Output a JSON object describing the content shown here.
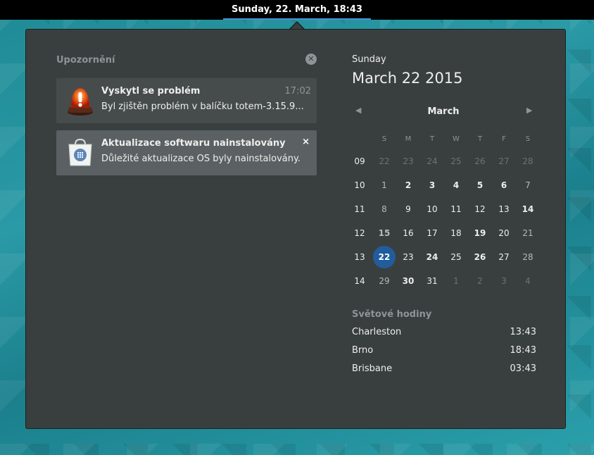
{
  "topbar": {
    "clock": "Sunday, 22. March, 18:43"
  },
  "notifications": {
    "header": "Upozornění",
    "clear_icon": "close-circle-icon",
    "items": [
      {
        "title": "Vyskytl se problém",
        "body": "Byl zjištěn problém v balíčku totem-3.15.9...",
        "time": "17:02",
        "icon": "alarm-beacon-icon"
      },
      {
        "title": "Aktualizace softwaru nainstalovány",
        "body": "Důležité aktualizace OS byly nainstalovány.",
        "close": "×",
        "icon": "software-bag-icon"
      }
    ]
  },
  "calendar": {
    "day_name": "Sunday",
    "full_date": "March 22 2015",
    "month": "March",
    "prev_icon": "triangle-left-icon",
    "next_icon": "triangle-right-icon",
    "weekdays": [
      "S",
      "M",
      "T",
      "W",
      "T",
      "F",
      "S"
    ],
    "weeks": [
      {
        "num": "09",
        "days": [
          "22",
          "23",
          "24",
          "25",
          "26",
          "27",
          "28"
        ]
      },
      {
        "num": "10",
        "days": [
          "1",
          "2",
          "3",
          "4",
          "5",
          "6",
          "7"
        ]
      },
      {
        "num": "11",
        "days": [
          "8",
          "9",
          "10",
          "11",
          "12",
          "13",
          "14"
        ]
      },
      {
        "num": "12",
        "days": [
          "15",
          "16",
          "17",
          "18",
          "19",
          "20",
          "21"
        ]
      },
      {
        "num": "13",
        "days": [
          "22",
          "23",
          "24",
          "25",
          "26",
          "27",
          "28"
        ]
      },
      {
        "num": "14",
        "days": [
          "29",
          "30",
          "31",
          "1",
          "2",
          "3",
          "4"
        ]
      }
    ],
    "today": "22"
  },
  "world_clocks": {
    "header": "Světové hodiny",
    "items": [
      {
        "city": "Charleston",
        "time": "13:43"
      },
      {
        "city": "Brno",
        "time": "18:43"
      },
      {
        "city": "Brisbane",
        "time": "03:43"
      }
    ]
  }
}
